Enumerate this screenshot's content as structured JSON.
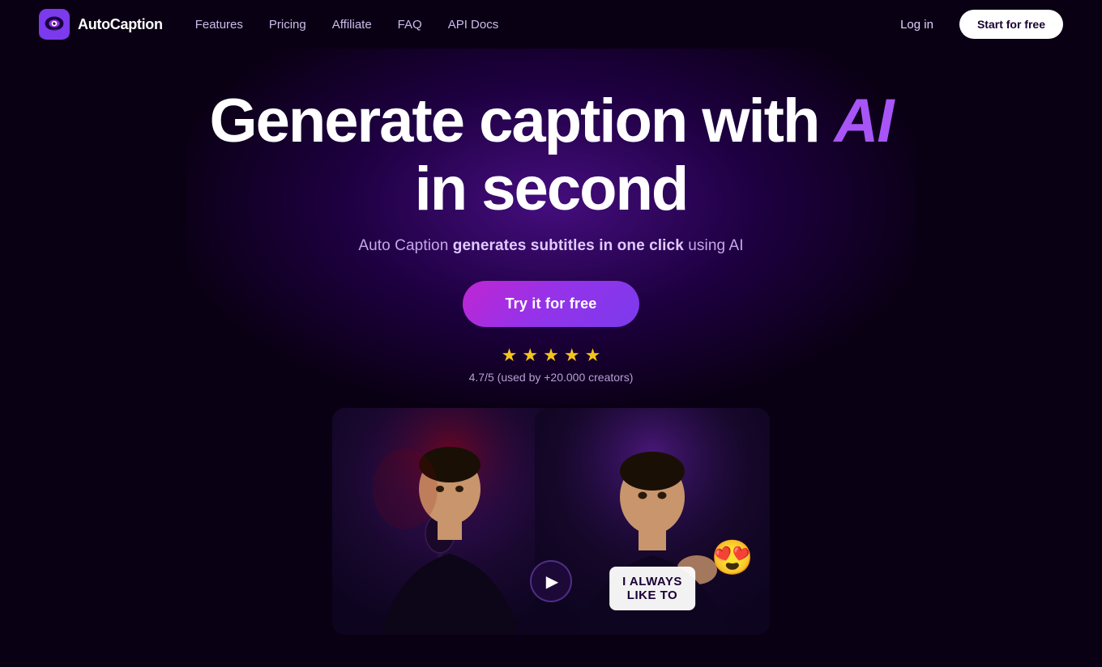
{
  "brand": {
    "name": "AutoCaption",
    "logo_alt": "AutoCaption logo"
  },
  "nav": {
    "links": [
      {
        "label": "Features",
        "id": "features"
      },
      {
        "label": "Pricing",
        "id": "pricing"
      },
      {
        "label": "Affiliate",
        "id": "affiliate"
      },
      {
        "label": "FAQ",
        "id": "faq"
      },
      {
        "label": "API Docs",
        "id": "api-docs"
      }
    ],
    "login_label": "Log in",
    "start_label": "Start for free"
  },
  "hero": {
    "headline_part1": "Generate caption with",
    "headline_ai": "AI",
    "headline_line2": "in second",
    "subtitle_before": "Auto Caption ",
    "subtitle_highlight": "generates subtitles in one click",
    "subtitle_after": " using AI",
    "cta_label": "Try it for free",
    "rating_stars": 5,
    "rating_value": "4.7/5",
    "rating_detail": "(used by +20.000 creators)"
  },
  "videos": {
    "left_alt": "Person speaking into microphone - before captions",
    "right_alt": "Person speaking with AI captions - after",
    "caption_text": "I ALWAYS\nLIKE TO",
    "arrow_label": "Next"
  }
}
